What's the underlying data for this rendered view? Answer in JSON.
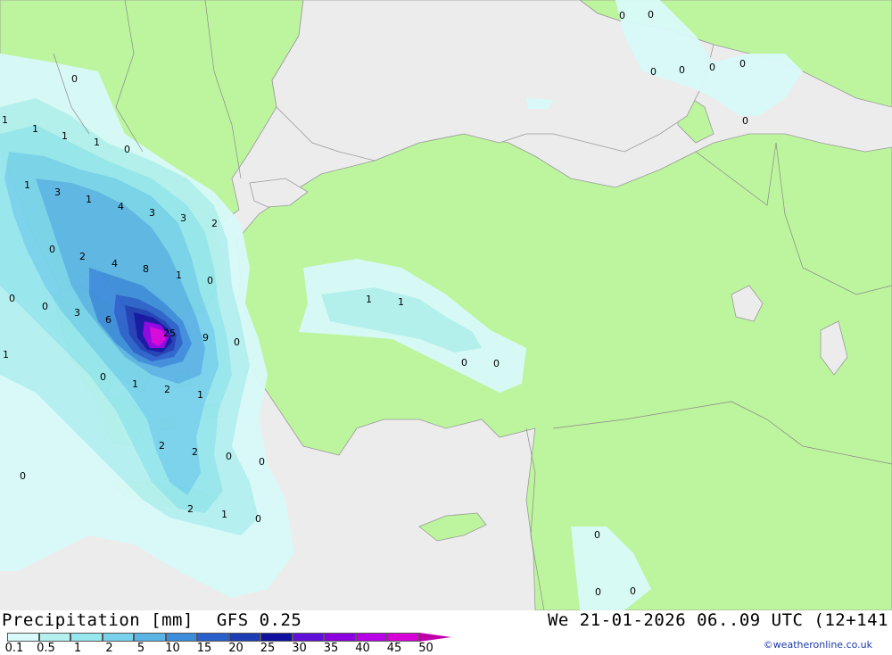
{
  "title": {
    "product": "Precipitation [mm]",
    "model": "GFS 0.25",
    "validity": "We 21-01-2026 06..09 UTC (12+141"
  },
  "credit": "©weatheronline.co.uk",
  "legend": {
    "items": [
      {
        "label": "0.1",
        "color": "#d8fafa"
      },
      {
        "label": "0.5",
        "color": "#b4f0f0"
      },
      {
        "label": "1",
        "color": "#96e6ee"
      },
      {
        "label": "2",
        "color": "#78d2ec"
      },
      {
        "label": "5",
        "color": "#5ab4e6"
      },
      {
        "label": "10",
        "color": "#3c8cdc"
      },
      {
        "label": "15",
        "color": "#2a60cc"
      },
      {
        "label": "20",
        "color": "#1e3cb4"
      },
      {
        "label": "25",
        "color": "#1010a0"
      },
      {
        "label": "30",
        "color": "#6010d8"
      },
      {
        "label": "35",
        "color": "#8c00e0"
      },
      {
        "label": "40",
        "color": "#b800e6"
      },
      {
        "label": "45",
        "color": "#d800d8"
      },
      {
        "label": "50",
        "color": "#c000a8"
      }
    ]
  },
  "colors": {
    "land": "#bdf49e",
    "sea": "#ececec",
    "border": "#9a9a9a"
  },
  "map_values": [
    "0",
    "0",
    "0",
    "0",
    "0",
    "0",
    "0",
    "1",
    "1",
    "1",
    "1",
    "0",
    "1",
    "3",
    "1",
    "4",
    "3",
    "3",
    "2",
    "0",
    "2",
    "4",
    "8",
    "1",
    "0",
    "0",
    "0",
    "3",
    "6",
    "9",
    "0",
    "1",
    "0",
    "1",
    "2",
    "1",
    "2",
    "2",
    "0",
    "0",
    "0",
    "2",
    "1",
    "0",
    "1",
    "1",
    "0",
    "0",
    "0",
    "0",
    "0",
    "0",
    "0",
    "25"
  ]
}
